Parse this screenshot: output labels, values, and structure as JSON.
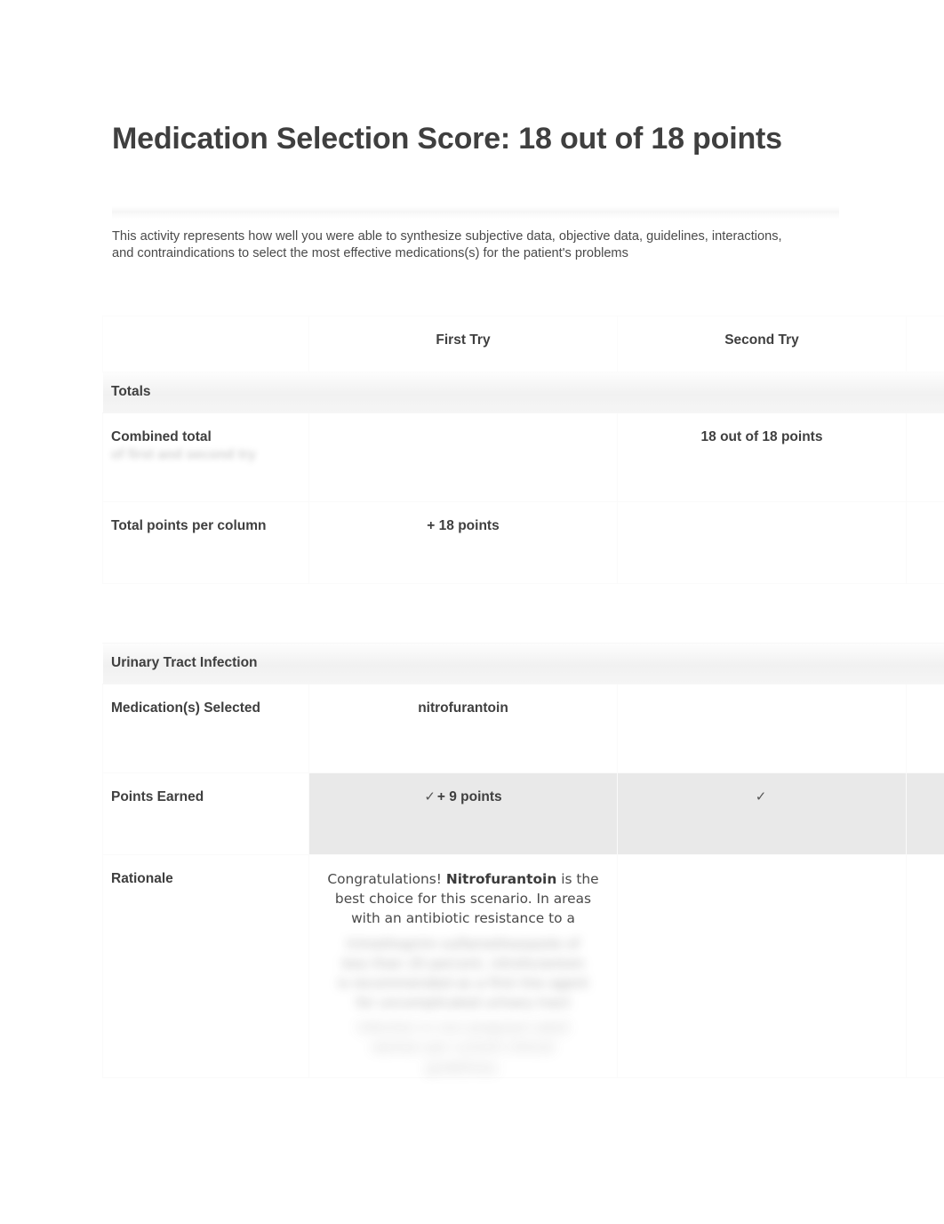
{
  "page": {
    "title": "Medication Selection Score: 18 out of 18 points",
    "intro": "This activity represents how well you were able to synthesize subjective data, objective data, guidelines, interactions, and contraindications to select the most effective medications(s) for the patient's problems"
  },
  "table": {
    "columns": {
      "label": "",
      "first_try": "First Try",
      "second_try": "Second Try"
    },
    "totals_section": {
      "heading": "Totals",
      "rows": [
        {
          "label": "Combined total",
          "label_continuation": "of first and second try",
          "first_try": "",
          "second_try": "18 out of 18 points"
        },
        {
          "label": "Total points per column",
          "first_try": "+ 18 points",
          "second_try": ""
        }
      ]
    },
    "uti_section": {
      "heading": "Urinary Tract Infection",
      "rows": [
        {
          "label": "Medication(s) Selected",
          "first_try": "nitrofurantoin",
          "second_try": ""
        },
        {
          "label": "Points Earned",
          "first_try_check": "✓",
          "first_try": "+ 9 points",
          "second_try_check": "✓",
          "second_try": ""
        },
        {
          "label": "Rationale",
          "first_try_intro": "Congratulations! ",
          "first_try_bold": "Nitrofurantoin",
          "first_try_rest": " is the best choice for this scenario. In areas with an antibiotic resistance to a",
          "first_try_obscured_1": "trimethoprim sulfamethoxazole of",
          "first_try_obscured_2": "less than 20 percent, nitrofurantoin",
          "first_try_obscured_3": "is recommended as a first line agent",
          "first_try_obscured_4": "for uncomplicated urinary tract",
          "first_try_obscured_5": "infection in non pregnant adult",
          "first_try_obscured_6": "women per current clinical",
          "first_try_obscured_7": "guidelines.",
          "second_try": ""
        }
      ]
    }
  },
  "icons": {
    "check": "✓"
  },
  "colors": {
    "text": "#444444",
    "heading": "#3f3f3f",
    "band_background": "#f1f1f1",
    "highlight_row": "#e9e9e9",
    "page_background": "#ffffff"
  }
}
